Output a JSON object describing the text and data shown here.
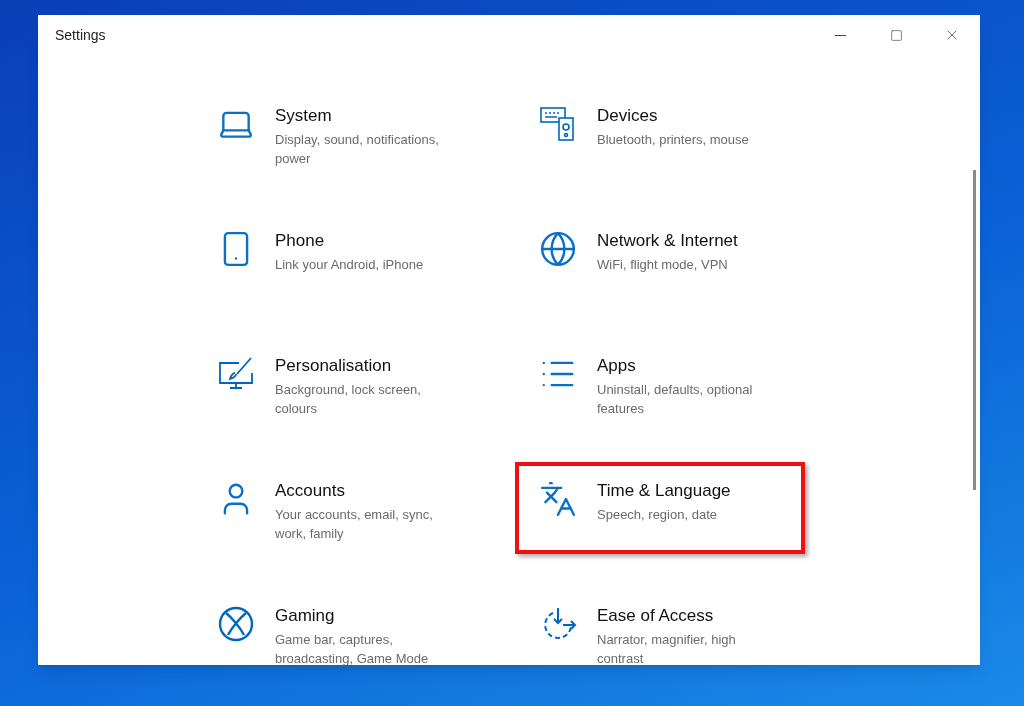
{
  "window": {
    "title": "Settings"
  },
  "categories": [
    {
      "kind": "system",
      "name": "System",
      "description": "Display, sound, notifications, power",
      "highlighted": false
    },
    {
      "kind": "devices",
      "name": "Devices",
      "description": "Bluetooth, printers, mouse",
      "highlighted": false
    },
    {
      "kind": "phone",
      "name": "Phone",
      "description": "Link your Android, iPhone",
      "highlighted": false
    },
    {
      "kind": "network",
      "name": "Network & Internet",
      "description": "WiFi, flight mode, VPN",
      "highlighted": false
    },
    {
      "kind": "personalisation",
      "name": "Personalisation",
      "description": "Background, lock screen, colours",
      "highlighted": false
    },
    {
      "kind": "apps",
      "name": "Apps",
      "description": "Uninstall, defaults, optional features",
      "highlighted": false
    },
    {
      "kind": "accounts",
      "name": "Accounts",
      "description": "Your accounts, email, sync, work, family",
      "highlighted": false
    },
    {
      "kind": "time",
      "name": "Time & Language",
      "description": "Speech, region, date",
      "highlighted": true
    },
    {
      "kind": "gaming",
      "name": "Gaming",
      "description": "Game bar, captures, broadcasting, Game Mode",
      "highlighted": false
    },
    {
      "kind": "ease",
      "name": "Ease of Access",
      "description": "Narrator, magnifier, high contrast",
      "highlighted": false
    }
  ]
}
